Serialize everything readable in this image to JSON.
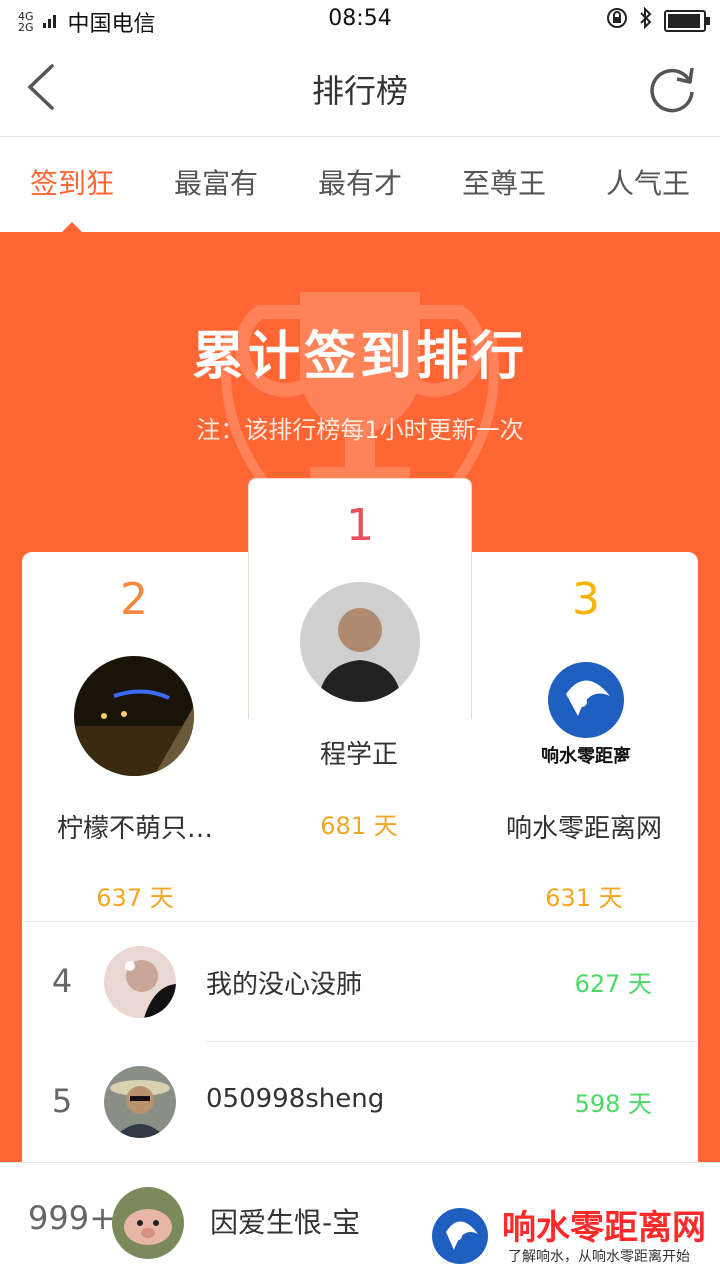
{
  "status": {
    "signal_top": "4G",
    "signal_bottom": "2G",
    "carrier": "中国电信",
    "time": "08:54"
  },
  "nav": {
    "title": "排行榜",
    "back_icon": "chevron-left-icon",
    "refresh_icon": "refresh-icon"
  },
  "tabs": [
    {
      "label": "签到狂",
      "active": true
    },
    {
      "label": "最富有",
      "active": false
    },
    {
      "label": "最有才",
      "active": false
    },
    {
      "label": "至尊王",
      "active": false
    },
    {
      "label": "人气王",
      "active": false
    }
  ],
  "hero": {
    "title": "累计签到排行",
    "note": "注：该排行榜每1小时更新一次"
  },
  "podium": {
    "first": {
      "rank": "1",
      "name": "程学正",
      "days": "681 天"
    },
    "second": {
      "rank": "2",
      "name": "柠檬不萌只…",
      "days": "637 天"
    },
    "third": {
      "rank": "3",
      "name": "响水零距离网",
      "days": "631 天",
      "avatar_text": "响水零距离"
    }
  },
  "list": [
    {
      "rank": "4",
      "name": "我的没心没肺",
      "days": "627 天"
    },
    {
      "rank": "5",
      "name": "050998sheng",
      "days": "598 天"
    }
  ],
  "me": {
    "rank": "999+",
    "name": "因爱生恨-宝"
  },
  "watermark": {
    "title": "响水零距离网",
    "subtitle": "了解响水，从响水零距离开始"
  },
  "colors": {
    "accent": "#ff6634",
    "gold": "#f5a623",
    "green": "#4cd964",
    "first": "#e8505b",
    "second": "#f58a3c",
    "third": "#f5b400"
  }
}
